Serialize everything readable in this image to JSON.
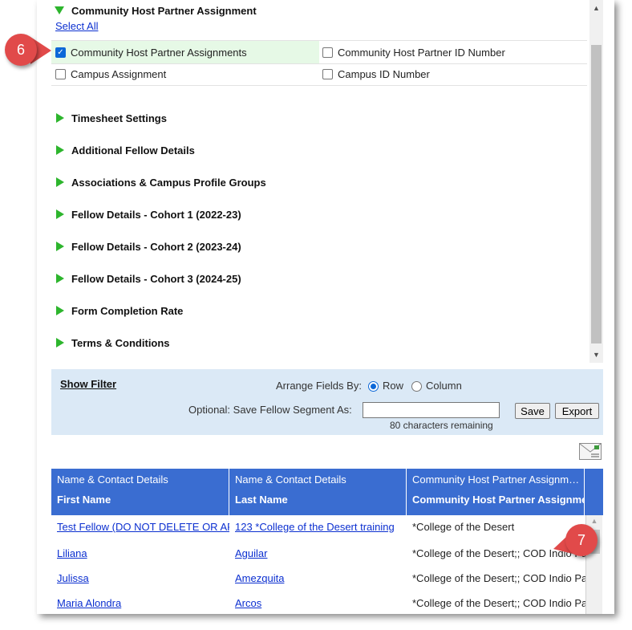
{
  "section_open": {
    "title": "Community Host Partner Assignment",
    "select_all": "Select All",
    "checkboxes": [
      {
        "label": "Community Host Partner Assignments",
        "checked": true
      },
      {
        "label": "Community Host Partner ID Number",
        "checked": false
      },
      {
        "label": "Campus Assignment",
        "checked": false
      },
      {
        "label": "Campus ID Number",
        "checked": false
      }
    ]
  },
  "collapsed_sections": [
    "Timesheet Settings",
    "Additional Fellow Details",
    "Associations & Campus Profile Groups",
    "Fellow Details - Cohort 1 (2022-23)",
    "Fellow Details - Cohort 2 (2023-24)",
    "Fellow Details - Cohort 3 (2024-25)",
    "Form Completion Rate",
    "Terms & Conditions"
  ],
  "filter": {
    "show_filter": "Show Filter",
    "arrange_label": "Arrange Fields By:",
    "option_row": "Row",
    "option_column": "Column",
    "selected": "Row",
    "save_segment_label": "Optional: Save Fellow Segment As:",
    "segment_value": "",
    "chars_remaining": "80 characters remaining",
    "save_button": "Save",
    "export_button": "Export"
  },
  "icons": {
    "email": "email-icon",
    "expanded": "triangle-down-icon",
    "collapsed": "triangle-right-icon"
  },
  "table": {
    "headers": [
      {
        "group": "Name & Contact Details",
        "field": "First Name"
      },
      {
        "group": "Name & Contact Details",
        "field": "Last Name"
      },
      {
        "group": "Community Host Partner Assignm…",
        "field": "Community Host Partner Assignme"
      }
    ],
    "rows": [
      {
        "first": "Test Fellow (DO NOT DELETE OR AF",
        "last": "123 *College of the Desert training",
        "assignment": "*College of the Desert"
      },
      {
        "first": "Liliana",
        "last": "Aguilar",
        "assignment": "*College of the Desert;; COD Indio Pa"
      },
      {
        "first": "Julissa",
        "last": "Amezquita",
        "assignment": "*College of the Desert;; COD Indio Pa"
      },
      {
        "first": "Maria Alondra",
        "last": "Arcos",
        "assignment": "*College of the Desert;; COD Indio Pa"
      }
    ]
  },
  "callouts": [
    "6",
    "7"
  ],
  "colors": {
    "accent_green": "#2db52d",
    "header_blue": "#3a6dd1",
    "filter_bg": "#dbe9f6",
    "callout_red": "#e14a4a",
    "checked_row_bg": "#e6f9e6"
  }
}
